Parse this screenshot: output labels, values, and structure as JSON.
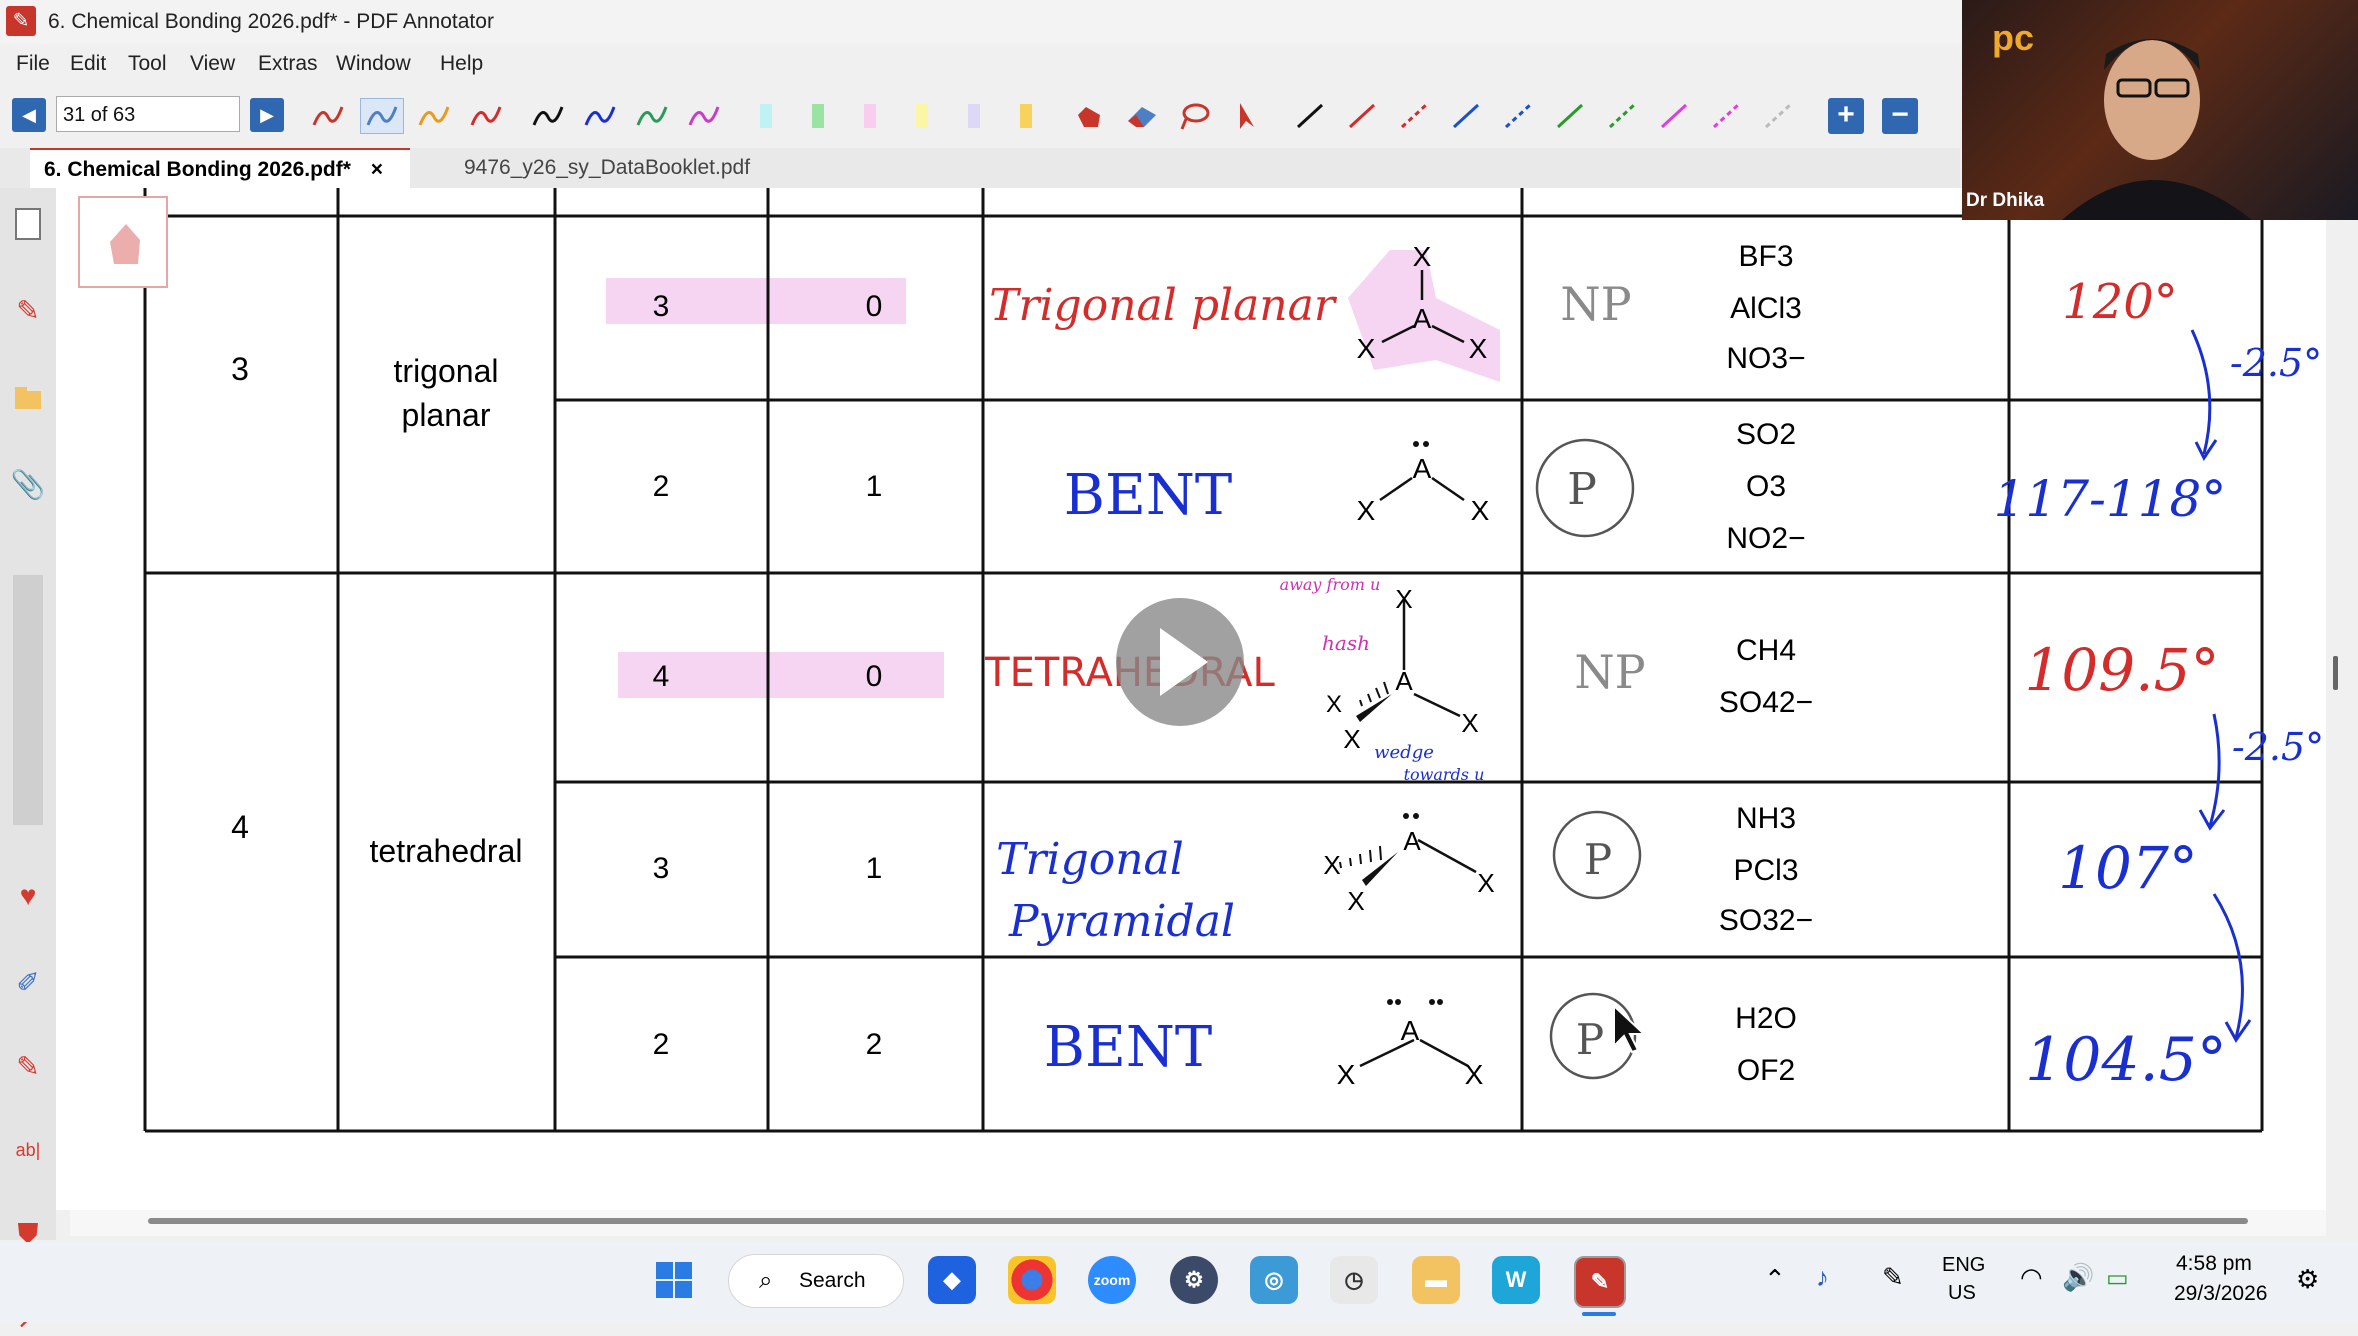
{
  "window": {
    "title": "6. Chemical Bonding 2026.pdf* - PDF Annotator"
  },
  "menu": [
    "File",
    "Edit",
    "Tool",
    "View",
    "Extras",
    "Window",
    "Help"
  ],
  "toolbar": {
    "page_indicator": "31 of 63"
  },
  "tabs": [
    {
      "label": "6. Chemical Bonding 2026.pdf*",
      "close": "×"
    },
    {
      "label": "9476_y26_sy_DataBooklet.pdf"
    }
  ],
  "video": {
    "presenter": "Dr Dhika",
    "logo": "pc"
  },
  "table": {
    "rows": [
      {
        "domains": "3",
        "geometry_line1": "trigonal",
        "geometry_line2": "planar",
        "sub": [
          {
            "bp": "3",
            "lp": "0",
            "shape": "Trigonal planar",
            "polarity": "NP",
            "examples": [
              "BF3",
              "AlCl3",
              "NO3−"
            ],
            "angle": "120°"
          },
          {
            "bp": "2",
            "lp": "1",
            "shape": "BENT",
            "polarity": "P",
            "examples": [
              "SO2",
              "O3",
              "NO2−"
            ],
            "angle": "117-118°"
          }
        ]
      },
      {
        "domains": "4",
        "geometry_line1": "tetrahedral",
        "geometry_line2": "",
        "sub": [
          {
            "bp": "4",
            "lp": "0",
            "shape": "TETRAHEDRAL",
            "polarity": "NP",
            "examples": [
              "CH4",
              "SO42−"
            ],
            "angle": "109.5°"
          },
          {
            "bp": "3",
            "lp": "1",
            "shape_line1": "Trigonal",
            "shape_line2": "Pyramidal",
            "polarity": "P",
            "examples": [
              "NH3",
              "PCl3",
              "SO32−"
            ],
            "angle": "107°"
          },
          {
            "bp": "2",
            "lp": "2",
            "shape": "BENT",
            "polarity": "P",
            "examples": [
              "H2O",
              "OF2"
            ],
            "angle": "104.5°"
          }
        ]
      }
    ],
    "angle_drop_1": "-2.5°",
    "angle_drop_2": "-2.5°",
    "annot_away": "away from u",
    "annot_hash": "hash",
    "annot_wedge": "wedge",
    "annot_towards": "towards u",
    "atom_center": "A",
    "atom_outer": "X"
  },
  "taskbar": {
    "search_label": "Search",
    "lang_line1": "ENG",
    "lang_line2": "US",
    "time": "4:58 pm",
    "date": "29/3/2026"
  },
  "colors": {
    "accent_red": "#c7352b",
    "ink_red": "#d42b2b",
    "ink_blue": "#1a2fd0",
    "ink_magenta": "#d12fb7",
    "highlight_pink": "#f6d5f3",
    "nav_blue": "#2f68b0"
  }
}
